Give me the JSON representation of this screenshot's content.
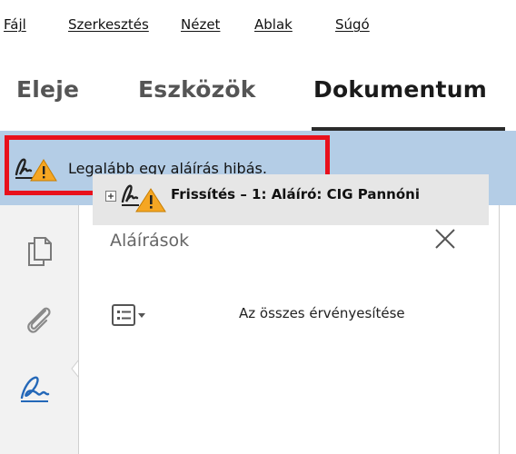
{
  "menubar": {
    "items": [
      {
        "label": "Fájl"
      },
      {
        "label": "Szerkesztés"
      },
      {
        "label": "Nézet"
      },
      {
        "label": "Ablak"
      },
      {
        "label": "Súgó"
      }
    ]
  },
  "tabs": [
    {
      "label": "Eleje",
      "active": false
    },
    {
      "label": "Eszközök",
      "active": false
    },
    {
      "label": "Dokumentum",
      "active": true
    }
  ],
  "notice": {
    "icon": "signature-warning-icon",
    "text": "Legalább egy aláírás hibás.",
    "background": "#b4cde6",
    "highlight_color": "#e8101c"
  },
  "rail": {
    "icons": [
      "pages-icon",
      "attachment-icon",
      "signature-icon"
    ]
  },
  "panel": {
    "title": "Aláírások",
    "close_icon": "close-icon",
    "options_icon": "list-options-icon",
    "validate_all_label": "Az összes érvényesítése",
    "signature_row": {
      "text": "Frissítés – 1: Aláíró: CIG Pannóni",
      "icon": "signature-warning-icon",
      "expand_icon": "plus-box-icon"
    }
  },
  "colors": {
    "warning": "#f5a623",
    "accent_bar": "#b4cde6",
    "rail_bg": "#f2f2f2"
  }
}
